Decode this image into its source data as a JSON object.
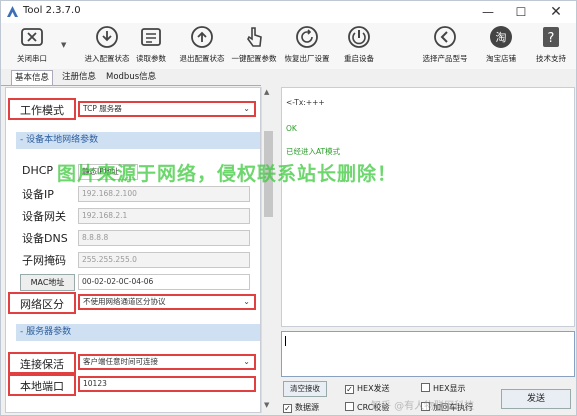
{
  "window": {
    "title": "Tool 2.3.7.0",
    "min": "—",
    "max": "☐",
    "close": "✕"
  },
  "toolbar": [
    {
      "label": "关闭串口",
      "icon": "close-port-icon"
    },
    {
      "label": "进入配置状态",
      "icon": "enter-config-icon"
    },
    {
      "label": "读取参数",
      "icon": "read-params-icon"
    },
    {
      "label": "退出配置状态",
      "icon": "exit-config-icon"
    },
    {
      "label": "一键配置参数",
      "icon": "one-click-config-icon"
    },
    {
      "label": "恢复出厂设置",
      "icon": "factory-reset-icon"
    },
    {
      "label": "重启设备",
      "icon": "restart-device-icon"
    },
    {
      "label": "选择产品型号",
      "icon": "select-model-icon"
    },
    {
      "label": "淘宝店铺",
      "icon": "taobao-store-icon"
    },
    {
      "label": "技术支持",
      "icon": "tech-support-icon"
    }
  ],
  "tabs": [
    "基本信息",
    "注册信息",
    "Modbus信息"
  ],
  "form": {
    "work_mode_label": "工作模式",
    "work_mode_value": "TCP 服务器",
    "section_local": "设备本地网络参数",
    "dhcp_label": "DHCP",
    "dhcp_value": "静态IP地址",
    "ip_label": "设备IP",
    "ip_value": "192.168.2.100",
    "gateway_label": "设备网关",
    "gateway_value": "192.168.2.1",
    "dns_label": "设备DNS",
    "dns_value": "8.8.8.8",
    "mask_label": "子网掩码",
    "mask_value": "255.255.255.0",
    "mac_button": "MAC地址",
    "mac_value": "00-02-02-0C-04-06",
    "net_partition_label": "网络区分",
    "net_partition_value": "不使用网络通道区分协议",
    "section_server": "服务器参数",
    "keepalive_label": "连接保活",
    "keepalive_value": "客户端任意时间可连接",
    "local_port_label": "本地端口",
    "local_port_value": "10123",
    "dash": "-"
  },
  "log": {
    "line1": "<-Tx:+++",
    "line2": "OK",
    "line3": "已经进入AT模式",
    "line1_color": "#333333",
    "line2_color": "#2a9d2a",
    "line3_color": "#2a9d2a"
  },
  "bottom": {
    "clear_receive": "清空接收",
    "hex_send": "HEX发送",
    "hex_display": "HEX显示",
    "data_source": "数据源",
    "crc_check": "CRC校验",
    "add_newline": "加回车执行",
    "send": "发送",
    "checked_mark": "✓"
  },
  "watermark": "图片来源于网络，侵权联系站长删除！",
  "watermark_bottom": "知乎 @有人物联网科技"
}
